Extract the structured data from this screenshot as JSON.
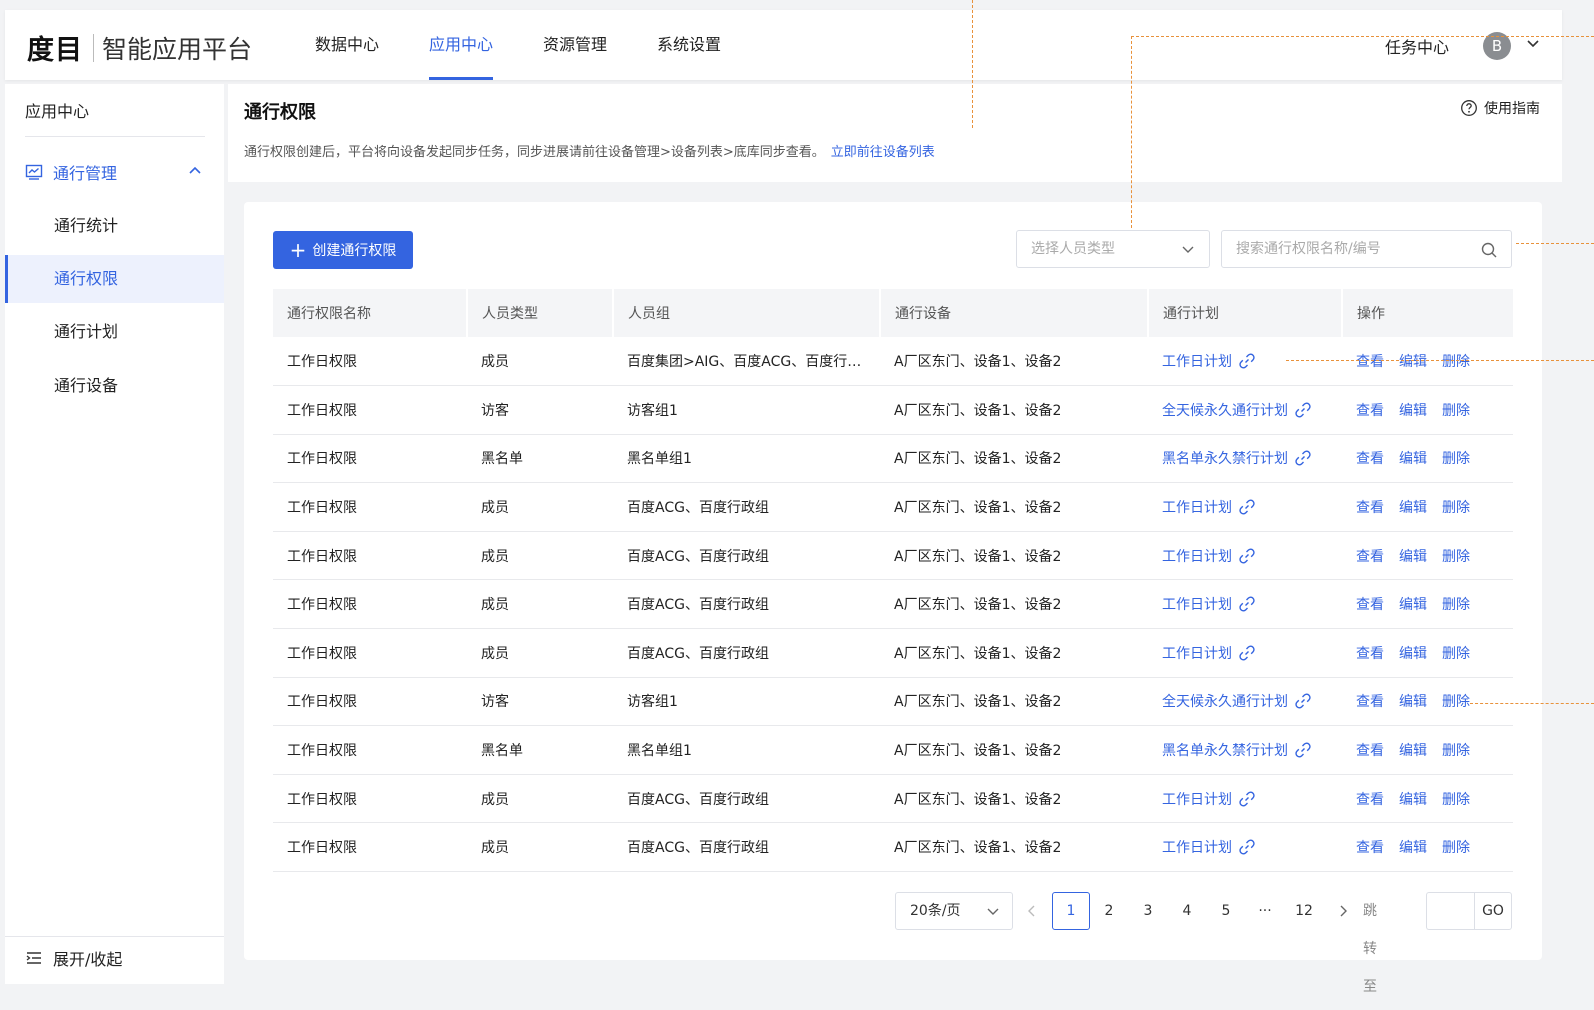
{
  "header": {
    "logo": "度目",
    "platform": "智能应用平台",
    "nav": [
      "数据中心",
      "应用中心",
      "资源管理",
      "系统设置"
    ],
    "active_nav": "应用中心",
    "task_center": "任务中心",
    "avatar_initial": "B"
  },
  "sidebar": {
    "title": "应用中心",
    "group_label": "通行管理",
    "items": [
      {
        "label": "通行统计",
        "active": false
      },
      {
        "label": "通行权限",
        "active": true
      },
      {
        "label": "通行计划",
        "active": false
      },
      {
        "label": "通行设备",
        "active": false
      }
    ],
    "toggle_label": "展开/收起"
  },
  "page": {
    "title": "通行权限",
    "description": "通行权限创建后，平台将向设备发起同步任务，同步进展请前往设备管理>设备列表>底库同步查看。",
    "link_label": "立即前往设备列表",
    "guide_label": "使用指南"
  },
  "toolbar": {
    "create_label": "创建通行权限",
    "type_select_placeholder": "选择人员类型",
    "search_placeholder": "搜索通行权限名称/编号"
  },
  "table": {
    "columns": [
      "通行权限名称",
      "人员类型",
      "人员组",
      "通行设备",
      "通行计划",
      "操作"
    ],
    "actions": [
      "查看",
      "编辑",
      "删除"
    ],
    "rows": [
      {
        "name": "工作日权限",
        "type": "成员",
        "group": "百度集团>AIG、百度ACG、百度行…",
        "device": "A厂区东门、设备1、设备2",
        "plan": "工作日计划"
      },
      {
        "name": "工作日权限",
        "type": "访客",
        "group": "访客组1",
        "device": "A厂区东门、设备1、设备2",
        "plan": "全天候永久通行计划"
      },
      {
        "name": "工作日权限",
        "type": "黑名单",
        "group": "黑名单组1",
        "device": "A厂区东门、设备1、设备2",
        "plan": "黑名单永久禁行计划"
      },
      {
        "name": "工作日权限",
        "type": "成员",
        "group": "百度ACG、百度行政组",
        "device": "A厂区东门、设备1、设备2",
        "plan": "工作日计划"
      },
      {
        "name": "工作日权限",
        "type": "成员",
        "group": "百度ACG、百度行政组",
        "device": "A厂区东门、设备1、设备2",
        "plan": "工作日计划"
      },
      {
        "name": "工作日权限",
        "type": "成员",
        "group": "百度ACG、百度行政组",
        "device": "A厂区东门、设备1、设备2",
        "plan": "工作日计划"
      },
      {
        "name": "工作日权限",
        "type": "成员",
        "group": "百度ACG、百度行政组",
        "device": "A厂区东门、设备1、设备2",
        "plan": "工作日计划"
      },
      {
        "name": "工作日权限",
        "type": "访客",
        "group": "访客组1",
        "device": "A厂区东门、设备1、设备2",
        "plan": "全天候永久通行计划"
      },
      {
        "name": "工作日权限",
        "type": "黑名单",
        "group": "黑名单组1",
        "device": "A厂区东门、设备1、设备2",
        "plan": "黑名单永久禁行计划"
      },
      {
        "name": "工作日权限",
        "type": "成员",
        "group": "百度ACG、百度行政组",
        "device": "A厂区东门、设备1、设备2",
        "plan": "工作日计划"
      },
      {
        "name": "工作日权限",
        "type": "成员",
        "group": "百度ACG、百度行政组",
        "device": "A厂区东门、设备1、设备2",
        "plan": "工作日计划"
      }
    ]
  },
  "pagination": {
    "page_size": "20条/页",
    "pages": [
      "1",
      "2",
      "3",
      "4",
      "5",
      "···",
      "12"
    ],
    "current": "1",
    "jump_label": "跳转至",
    "go_label": "GO"
  },
  "colors": {
    "accent": "#3464e0",
    "annotation": "#e8913b",
    "background": "#f2f3f5"
  }
}
